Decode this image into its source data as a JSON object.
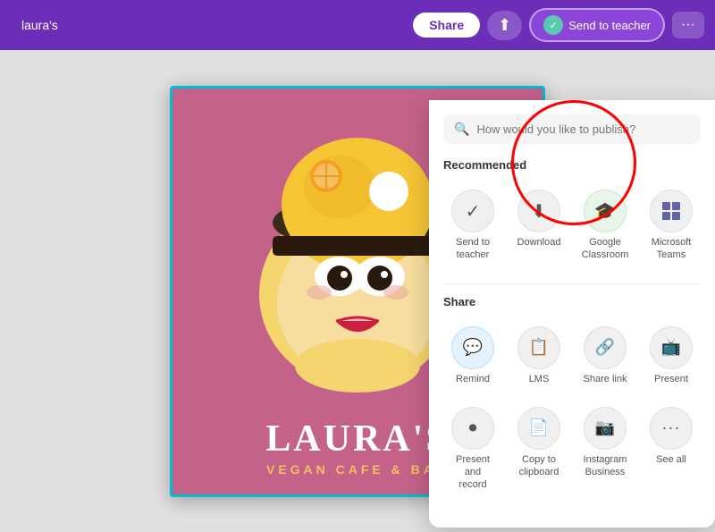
{
  "navbar": {
    "title": "laura's",
    "share_label": "Share",
    "upload_icon": "↑",
    "send_teacher_label": "Send to teacher",
    "more_icon": "···"
  },
  "dropdown": {
    "search_placeholder": "How would you like to publish?",
    "recommended_title": "Recommended",
    "share_title": "Share",
    "items_recommended": [
      {
        "id": "send-teacher",
        "label": "Send to\nteacher",
        "icon": "✓",
        "bg": "default"
      },
      {
        "id": "download",
        "label": "Download",
        "icon": "⬇",
        "bg": "default"
      },
      {
        "id": "google-classroom",
        "label": "Google\nClassroom",
        "icon": "🎓",
        "bg": "green"
      },
      {
        "id": "microsoft-teams",
        "label": "Microsoft\nTeams",
        "icon": "teams",
        "bg": "default"
      }
    ],
    "items_share": [
      {
        "id": "remind",
        "label": "Remind",
        "icon": "💬",
        "bg": "blue"
      },
      {
        "id": "lms",
        "label": "LMS",
        "icon": "📋",
        "bg": "default"
      },
      {
        "id": "share-link",
        "label": "Share link",
        "icon": "🔗",
        "bg": "default"
      },
      {
        "id": "present",
        "label": "Present",
        "icon": "📺",
        "bg": "default"
      },
      {
        "id": "present-record",
        "label": "Present and\nrecord",
        "icon": "⏺",
        "bg": "default"
      },
      {
        "id": "copy-clipboard",
        "label": "Copy to\nclipboard",
        "icon": "📄",
        "bg": "default"
      },
      {
        "id": "instagram",
        "label": "Instagram\nBusiness",
        "icon": "📷",
        "bg": "default"
      },
      {
        "id": "see-all",
        "label": "See all",
        "icon": "···",
        "bg": "default"
      }
    ]
  },
  "design": {
    "main_text": "LAURA'S",
    "sub_text": "VEGAN CAFE & BAR"
  }
}
